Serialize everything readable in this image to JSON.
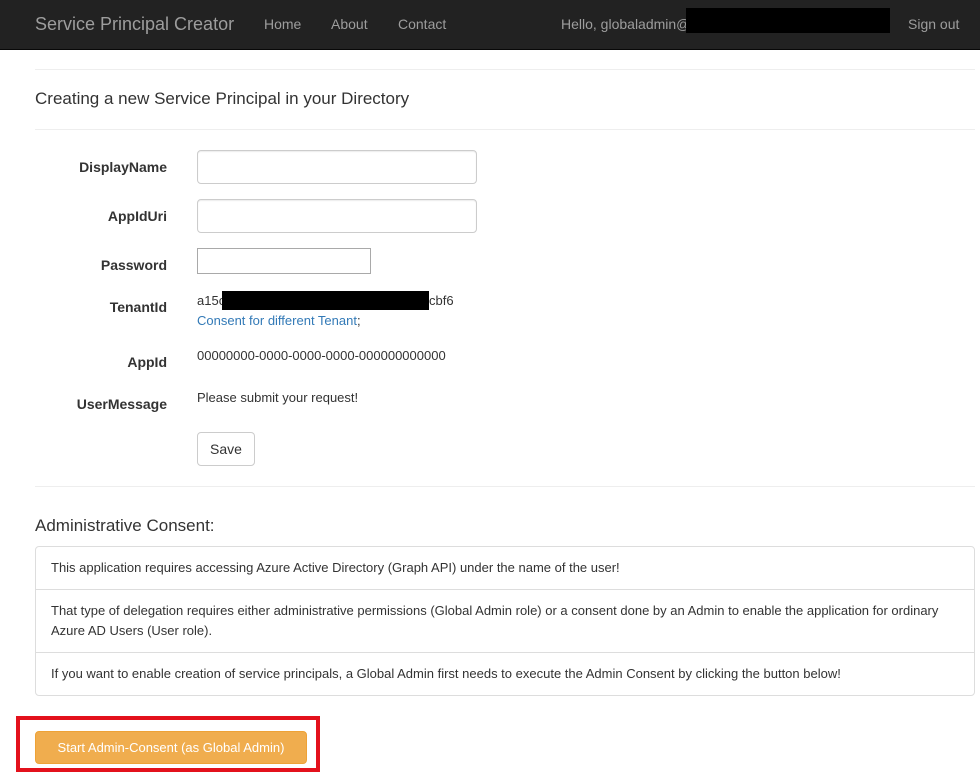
{
  "navbar": {
    "brand": "Service Principal Creator",
    "links": [
      "Home",
      "About",
      "Contact"
    ],
    "greeting": "Hello, globaladmin@",
    "signout": "Sign out"
  },
  "page": {
    "title": "Creating a new Service Principal in your Directory"
  },
  "form": {
    "display_name_label": "DisplayName",
    "display_name_value": "",
    "app_id_uri_label": "AppIdUri",
    "app_id_uri_value": "",
    "password_label": "Password",
    "password_value": "",
    "tenant_id_label": "TenantId",
    "tenant_id_prefix": "a15c",
    "tenant_id_suffix": "cbf6",
    "consent_link": "Consent for different Tenant",
    "consent_suffix": ";",
    "app_id_label": "AppId",
    "app_id_value": "00000000-0000-0000-0000-000000000000",
    "user_message_label": "UserMessage",
    "user_message_value": "Please submit your request!",
    "save_label": "Save"
  },
  "consent": {
    "heading": "Administrative Consent:",
    "items": [
      "This application requires accessing Azure Active Directory (Graph API) under the name of the user!",
      "That type of delegation requires either administrative permissions (Global Admin role) or a consent done by an Admin to enable the application for ordinary Azure AD Users (User role).",
      "If you want to enable creation of service principals, a Global Admin first needs to execute the Admin Consent by clicking the button below!"
    ],
    "button_label": "Start Admin-Consent (as Global Admin)"
  },
  "colors": {
    "navbar_bg": "#222222",
    "nav_text": "#9d9d9d",
    "link": "#337ab7",
    "warning_button": "#f0ad4e",
    "highlight_border": "#e3111c",
    "redaction": "#000000"
  },
  "icons": []
}
